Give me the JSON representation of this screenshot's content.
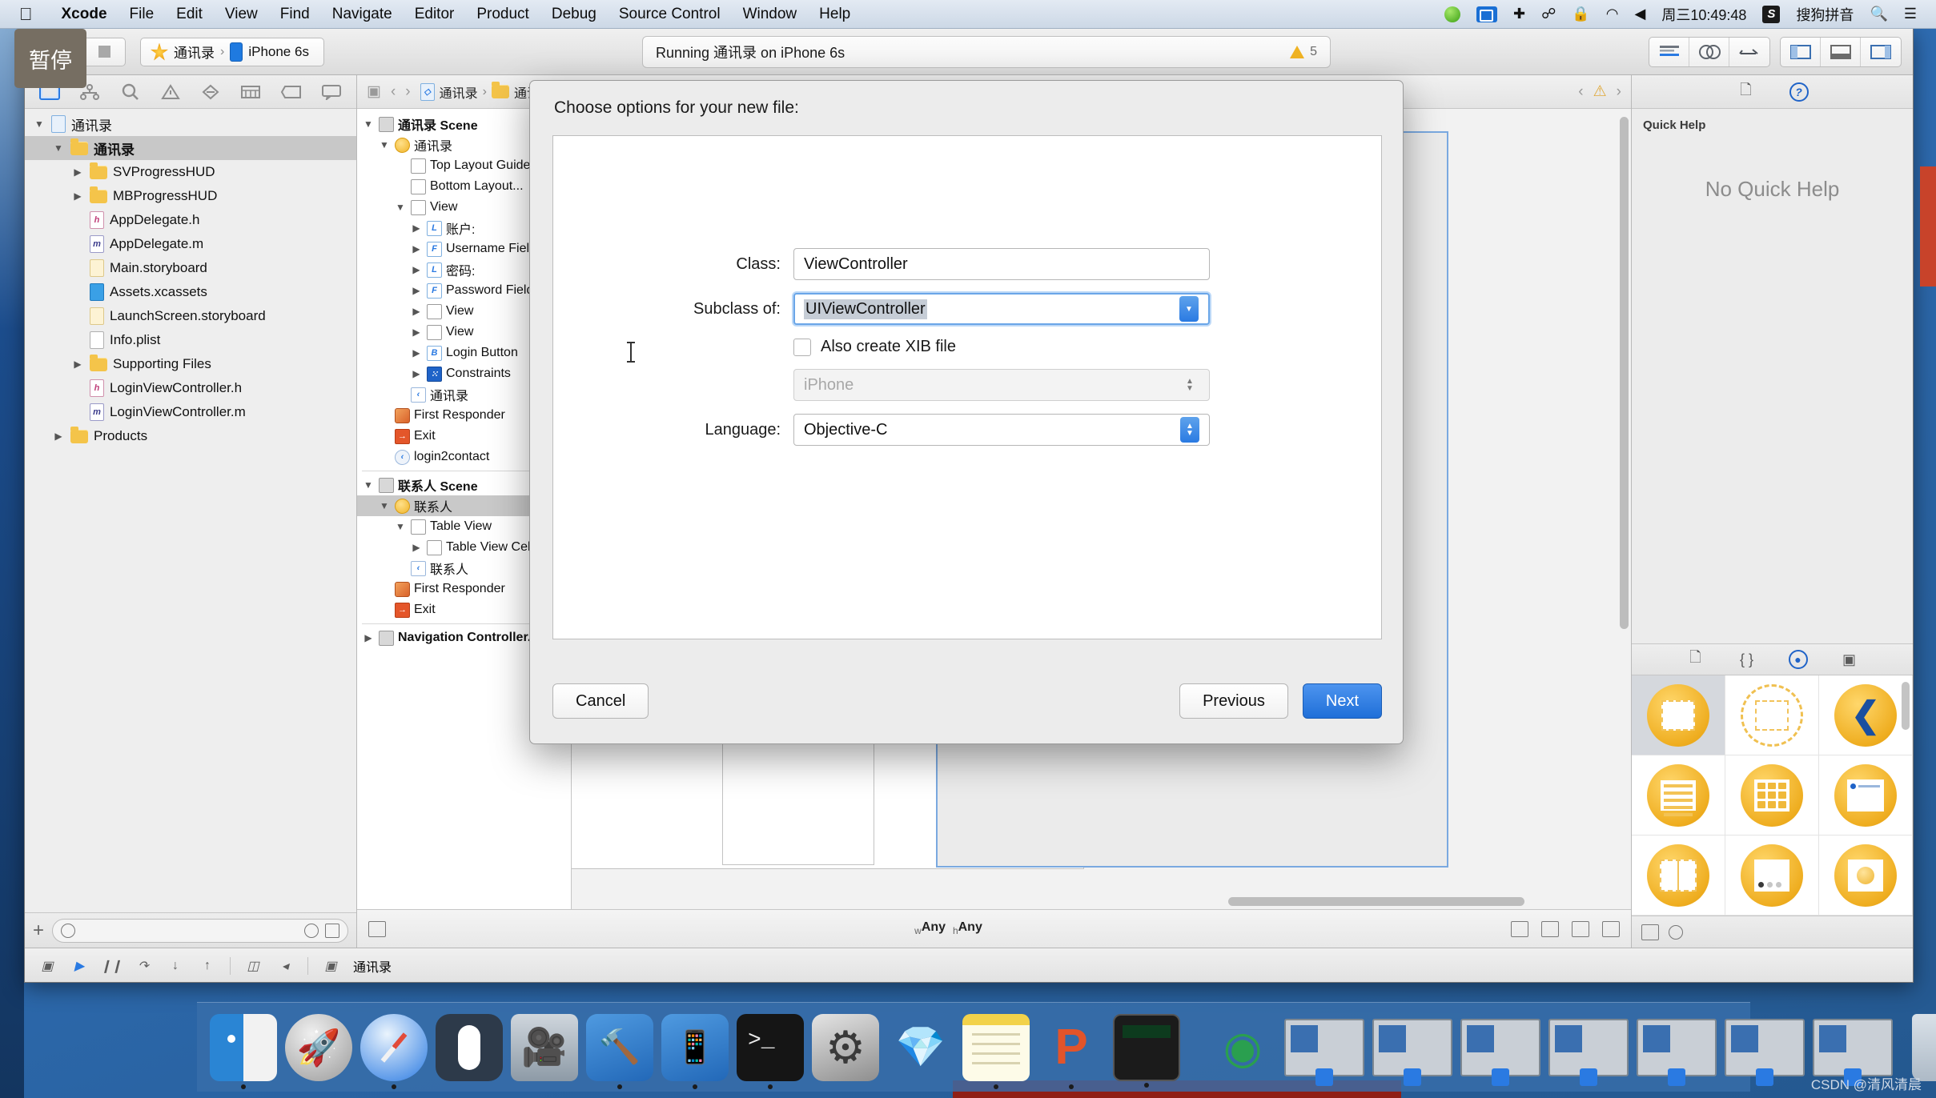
{
  "menubar": {
    "apple_icon": "apple-logo-icon",
    "items": [
      {
        "label": "Xcode",
        "bold": true
      },
      {
        "label": "File",
        "bold": false
      },
      {
        "label": "Edit",
        "bold": false
      },
      {
        "label": "View",
        "bold": false
      },
      {
        "label": "Find",
        "bold": false
      },
      {
        "label": "Navigate",
        "bold": false
      },
      {
        "label": "Editor",
        "bold": false
      },
      {
        "label": "Product",
        "bold": false
      },
      {
        "label": "Debug",
        "bold": false
      },
      {
        "label": "Source Control",
        "bold": false
      },
      {
        "label": "Window",
        "bold": false
      },
      {
        "label": "Help",
        "bold": false
      }
    ],
    "right": {
      "clock": "周三10:49:48",
      "input_method": "搜狗拼音",
      "icons": [
        "screen-record-icon",
        "airdrop-icon",
        "bluetooth-icon",
        "lock-icon",
        "wifi-icon",
        "volume-icon",
        "search-icon",
        "notification-center-icon"
      ]
    }
  },
  "tooltip": {
    "text": "暂停"
  },
  "toolbar": {
    "run_icon": "play-icon",
    "stop_icon": "stop-icon",
    "scheme_project": "通讯录",
    "scheme_separator": "›",
    "scheme_destination": "iPhone 6s",
    "status_text": "Running 通讯录 on iPhone 6s",
    "warning_icon": "warning-triangle-icon",
    "warning_count": "5",
    "right_icons": [
      "standard-editor-icon",
      "assistant-editor-icon",
      "version-editor-icon",
      "show-navigator-icon",
      "show-debug-area-icon",
      "show-utilities-icon"
    ]
  },
  "navigator": {
    "tabs": [
      "project-navigator-icon",
      "symbol-navigator-icon",
      "find-navigator-icon",
      "issue-navigator-icon",
      "test-navigator-icon",
      "debug-navigator-icon",
      "breakpoint-navigator-icon",
      "report-navigator-icon"
    ],
    "selected_tab": 0,
    "tree": [
      {
        "label": "通讯录",
        "indent": 0,
        "twisty": "▼",
        "icon": "project-icon",
        "kind": "proj",
        "selected": false
      },
      {
        "label": "通讯录",
        "indent": 1,
        "twisty": "▼",
        "icon": "folder-icon",
        "kind": "folder",
        "selected": true
      },
      {
        "label": "SVProgressHUD",
        "indent": 2,
        "twisty": "▶",
        "icon": "folder-icon",
        "kind": "folder",
        "selected": false
      },
      {
        "label": "MBProgressHUD",
        "indent": 2,
        "twisty": "▶",
        "icon": "folder-icon",
        "kind": "folder",
        "selected": false
      },
      {
        "label": "AppDelegate.h",
        "indent": 2,
        "twisty": "",
        "icon": "header-file-icon",
        "kind": "h",
        "selected": false
      },
      {
        "label": "AppDelegate.m",
        "indent": 2,
        "twisty": "",
        "icon": "source-file-icon",
        "kind": "m",
        "selected": false
      },
      {
        "label": "Main.storyboard",
        "indent": 2,
        "twisty": "",
        "icon": "storyboard-icon",
        "kind": "sb",
        "selected": false
      },
      {
        "label": "Assets.xcassets",
        "indent": 2,
        "twisty": "",
        "icon": "assets-icon",
        "kind": "xca",
        "selected": false
      },
      {
        "label": "LaunchScreen.storyboard",
        "indent": 2,
        "twisty": "",
        "icon": "storyboard-icon",
        "kind": "sb",
        "selected": false
      },
      {
        "label": "Info.plist",
        "indent": 2,
        "twisty": "",
        "icon": "plist-icon",
        "kind": "plist",
        "selected": false
      },
      {
        "label": "Supporting Files",
        "indent": 2,
        "twisty": "▶",
        "icon": "folder-icon",
        "kind": "folder",
        "selected": false
      },
      {
        "label": "LoginViewController.h",
        "indent": 2,
        "twisty": "",
        "icon": "header-file-icon",
        "kind": "h",
        "selected": false
      },
      {
        "label": "LoginViewController.m",
        "indent": 2,
        "twisty": "",
        "icon": "source-file-icon",
        "kind": "m",
        "selected": false
      },
      {
        "label": "Products",
        "indent": 1,
        "twisty": "▶",
        "icon": "folder-icon",
        "kind": "folder",
        "selected": false
      }
    ],
    "filter_placeholder": "",
    "add_icon": "plus-icon",
    "filter_icon": "filter-circle-icon",
    "recent_icon": "clock-icon",
    "source_ctl_icon": "source-control-icon"
  },
  "editor": {
    "back_icon": "‹",
    "forward_icon": "›",
    "breadcrumb": [
      "通讯录",
      "通讯录"
    ],
    "outline": [
      {
        "label": "通讯录 Scene",
        "indent": 0,
        "twisty": "▼",
        "kind": "scene",
        "glyph": "",
        "selected": false,
        "bold": true
      },
      {
        "label": "通讯录",
        "indent": 1,
        "twisty": "▼",
        "kind": "vc",
        "glyph": "",
        "selected": false,
        "bold": false
      },
      {
        "label": "Top Layout Guide",
        "indent": 2,
        "twisty": "",
        "kind": "guide",
        "glyph": "",
        "selected": false,
        "bold": false
      },
      {
        "label": "Bottom Layout...",
        "indent": 2,
        "twisty": "",
        "kind": "guide",
        "glyph": "",
        "selected": false,
        "bold": false
      },
      {
        "label": "View",
        "indent": 2,
        "twisty": "▼",
        "kind": "view",
        "glyph": "",
        "selected": false,
        "bold": false
      },
      {
        "label": "账户:",
        "indent": 3,
        "twisty": "▶",
        "kind": "label",
        "glyph": "L",
        "selected": false,
        "bold": false
      },
      {
        "label": "Username Field",
        "indent": 3,
        "twisty": "▶",
        "kind": "field",
        "glyph": "F",
        "selected": false,
        "bold": false
      },
      {
        "label": "密码:",
        "indent": 3,
        "twisty": "▶",
        "kind": "label",
        "glyph": "L",
        "selected": false,
        "bold": false
      },
      {
        "label": "Password Field",
        "indent": 3,
        "twisty": "▶",
        "kind": "field",
        "glyph": "F",
        "selected": false,
        "bold": false
      },
      {
        "label": "View",
        "indent": 3,
        "twisty": "▶",
        "kind": "view",
        "glyph": "",
        "selected": false,
        "bold": false
      },
      {
        "label": "View",
        "indent": 3,
        "twisty": "▶",
        "kind": "view",
        "glyph": "",
        "selected": false,
        "bold": false
      },
      {
        "label": "Login Button",
        "indent": 3,
        "twisty": "▶",
        "kind": "button",
        "glyph": "B",
        "selected": false,
        "bold": false
      },
      {
        "label": "Constraints",
        "indent": 3,
        "twisty": "▶",
        "kind": "constraints",
        "glyph": "⁙",
        "selected": false,
        "bold": false
      },
      {
        "label": "通讯录",
        "indent": 2,
        "twisty": "",
        "kind": "back",
        "glyph": "‹",
        "selected": false,
        "bold": false
      },
      {
        "label": "First Responder",
        "indent": 1,
        "twisty": "",
        "kind": "firstresponder",
        "glyph": "",
        "selected": false,
        "bold": false
      },
      {
        "label": "Exit",
        "indent": 1,
        "twisty": "",
        "kind": "exit",
        "glyph": "→",
        "selected": false,
        "bold": false
      },
      {
        "label": "login2contact",
        "indent": 1,
        "twisty": "",
        "kind": "segue",
        "glyph": "‹",
        "selected": false,
        "bold": false
      },
      {
        "label": "联系人 Scene",
        "indent": 0,
        "twisty": "▼",
        "kind": "scene",
        "glyph": "",
        "selected": false,
        "bold": true
      },
      {
        "label": "联系人",
        "indent": 1,
        "twisty": "▼",
        "kind": "vc",
        "glyph": "",
        "selected": true,
        "bold": false
      },
      {
        "label": "Table View",
        "indent": 2,
        "twisty": "▼",
        "kind": "view",
        "glyph": "",
        "selected": false,
        "bold": false
      },
      {
        "label": "Table View Cell",
        "indent": 3,
        "twisty": "▶",
        "kind": "cell",
        "glyph": "",
        "selected": false,
        "bold": false
      },
      {
        "label": "联系人",
        "indent": 2,
        "twisty": "",
        "kind": "back",
        "glyph": "‹",
        "selected": false,
        "bold": false
      },
      {
        "label": "First Responder",
        "indent": 1,
        "twisty": "",
        "kind": "firstresponder",
        "glyph": "",
        "selected": false,
        "bold": false
      },
      {
        "label": "Exit",
        "indent": 1,
        "twisty": "",
        "kind": "exit",
        "glyph": "→",
        "selected": false,
        "bold": false
      },
      {
        "label": "Navigation Controller...",
        "indent": 0,
        "twisty": "▶",
        "kind": "scene",
        "glyph": "",
        "selected": false,
        "bold": true
      }
    ],
    "bottom": {
      "device_icon": "device-icon",
      "size_class_w_prefix": "w",
      "size_class_w": "Any",
      "size_class_h_prefix": "h",
      "size_class_h": "Any",
      "right_icons": [
        "constraints-icon",
        "align-icon",
        "pin-icon",
        "resolve-issues-icon"
      ]
    }
  },
  "inspector": {
    "tabs": [
      "file-inspector-icon",
      "quick-help-icon"
    ],
    "selected_tab": 1,
    "quick_help_title": "Quick Help",
    "no_help_text": "No Quick Help",
    "library_tabs": [
      "file-template-library-icon",
      "code-snippet-library-icon",
      "object-library-icon",
      "media-library-icon"
    ],
    "library_selected_tab": 2,
    "library_items": [
      {
        "name": "view-controller-object",
        "kind": "vc",
        "selected": true
      },
      {
        "name": "storyboard-reference-object",
        "kind": "ghost",
        "selected": false
      },
      {
        "name": "navigation-controller-object",
        "kind": "chev",
        "selected": false
      },
      {
        "name": "table-view-controller-object",
        "kind": "bars",
        "selected": false
      },
      {
        "name": "collection-view-controller-object",
        "kind": "dots",
        "selected": false
      },
      {
        "name": "tab-bar-controller-object",
        "kind": "nav",
        "selected": false
      },
      {
        "name": "split-view-controller-object",
        "kind": "split",
        "selected": false
      },
      {
        "name": "page-view-controller-object",
        "kind": "page",
        "selected": false
      },
      {
        "name": "glkit-view-controller-object",
        "kind": "glass",
        "selected": false
      }
    ],
    "filter_placeholder": "",
    "filter_icon": "filter-circle-icon",
    "grid_view_icon": "grid-view-icon"
  },
  "debug_bar": {
    "icons": [
      "show-debug-area-icon",
      "continue-icon",
      "pause-icon",
      "step-over-icon",
      "step-into-icon",
      "step-out-icon",
      "simulate-location-icon",
      "view-hierarchy-icon",
      "stack-frame-icon"
    ],
    "process_label": "通讯录"
  },
  "dialog": {
    "title": "Choose options for your new file:",
    "fields": [
      {
        "label": "Class:",
        "value": "ViewController",
        "type": "text",
        "focused": false,
        "placeholder": ""
      },
      {
        "label": "Subclass of:",
        "value": "UIViewController",
        "type": "combo",
        "focused": true,
        "placeholder": ""
      },
      {
        "label": "Language:",
        "value": "Objective-C",
        "type": "popup",
        "focused": false,
        "placeholder": ""
      }
    ],
    "checkbox": {
      "label": "Also create XIB file",
      "checked": false
    },
    "device_popup": {
      "value": "iPhone",
      "disabled": true
    },
    "buttons": {
      "cancel": "Cancel",
      "previous": "Previous",
      "next": "Next"
    },
    "accent_color": "#1f6fd8"
  },
  "dock": {
    "items": [
      {
        "name": "finder-icon",
        "cls": "finder",
        "running": true
      },
      {
        "name": "launchpad-icon",
        "cls": "launchpad",
        "running": false
      },
      {
        "name": "safari-icon",
        "cls": "safari",
        "running": true
      },
      {
        "name": "mouse-app-icon",
        "cls": "mouse",
        "running": false
      },
      {
        "name": "quicktime-icon",
        "cls": "qt",
        "running": false
      },
      {
        "name": "xcode-icon",
        "cls": "xcodeapp",
        "running": true
      },
      {
        "name": "xcode-beta-icon",
        "cls": "xcodeapp2",
        "running": true
      },
      {
        "name": "terminal-icon",
        "cls": "term",
        "running": true
      },
      {
        "name": "system-preferences-icon",
        "cls": "sysprefs",
        "running": false
      },
      {
        "name": "sketch-icon",
        "cls": "sketch",
        "running": false
      },
      {
        "name": "notes-icon",
        "cls": "notes",
        "running": true
      },
      {
        "name": "powerpoint-icon",
        "cls": "pptapp",
        "running": true
      },
      {
        "name": "calculator-icon",
        "cls": "calc",
        "running": true
      }
    ],
    "minimized": [
      {
        "name": "chrome-icon",
        "cls": "chromeapp"
      }
    ],
    "window_thumbs": 7,
    "trash_icon": "trash-icon"
  },
  "watermark": "CSDN @清风清晨"
}
